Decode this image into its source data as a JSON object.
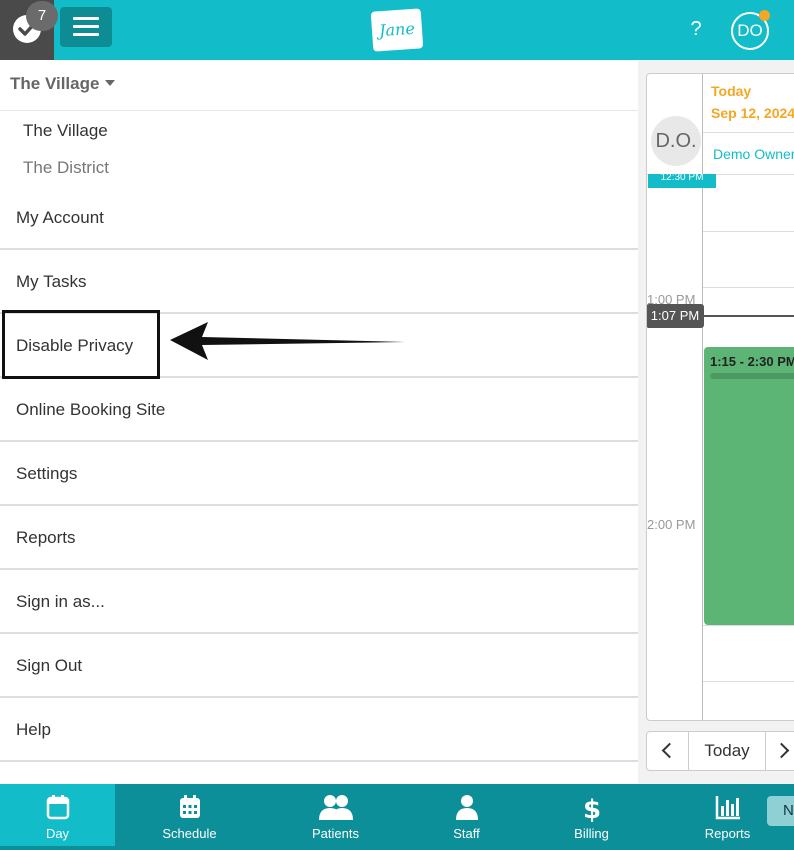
{
  "topbar": {
    "task_count": "7",
    "help_label": "?",
    "avatar_initials": "DO",
    "logo_text": "Jane"
  },
  "menu": {
    "location_selected": "The Village",
    "locations": [
      "The Village",
      "The District"
    ],
    "items": [
      "My Account",
      "My Tasks",
      "Disable Privacy",
      "Online Booking Site",
      "Settings",
      "Reports",
      "Sign in as...",
      "Sign Out",
      "Help"
    ]
  },
  "calendar": {
    "today_label": "Today",
    "date": "Sep 12, 2024",
    "staff_initials": "D.O.",
    "staff_name": "Demo Owner",
    "chip_1230": "12:30 PM",
    "time_1pm": "1:00 PM",
    "now_time": "1:07 PM",
    "appt_time": "1:15 - 2:30 PM",
    "time_2pm": "2:00 PM",
    "nav_today": "Today"
  },
  "bottom_nav": {
    "tabs": [
      "Day",
      "Schedule",
      "Patients",
      "Staff",
      "Billing",
      "Reports"
    ],
    "extra": "N",
    "active_tab": "Day"
  },
  "colors": {
    "brand": "#12bcc8",
    "brand_dark": "#0c8f98",
    "accent_orange": "#f5a623",
    "appointment_green": "#5cb574"
  }
}
